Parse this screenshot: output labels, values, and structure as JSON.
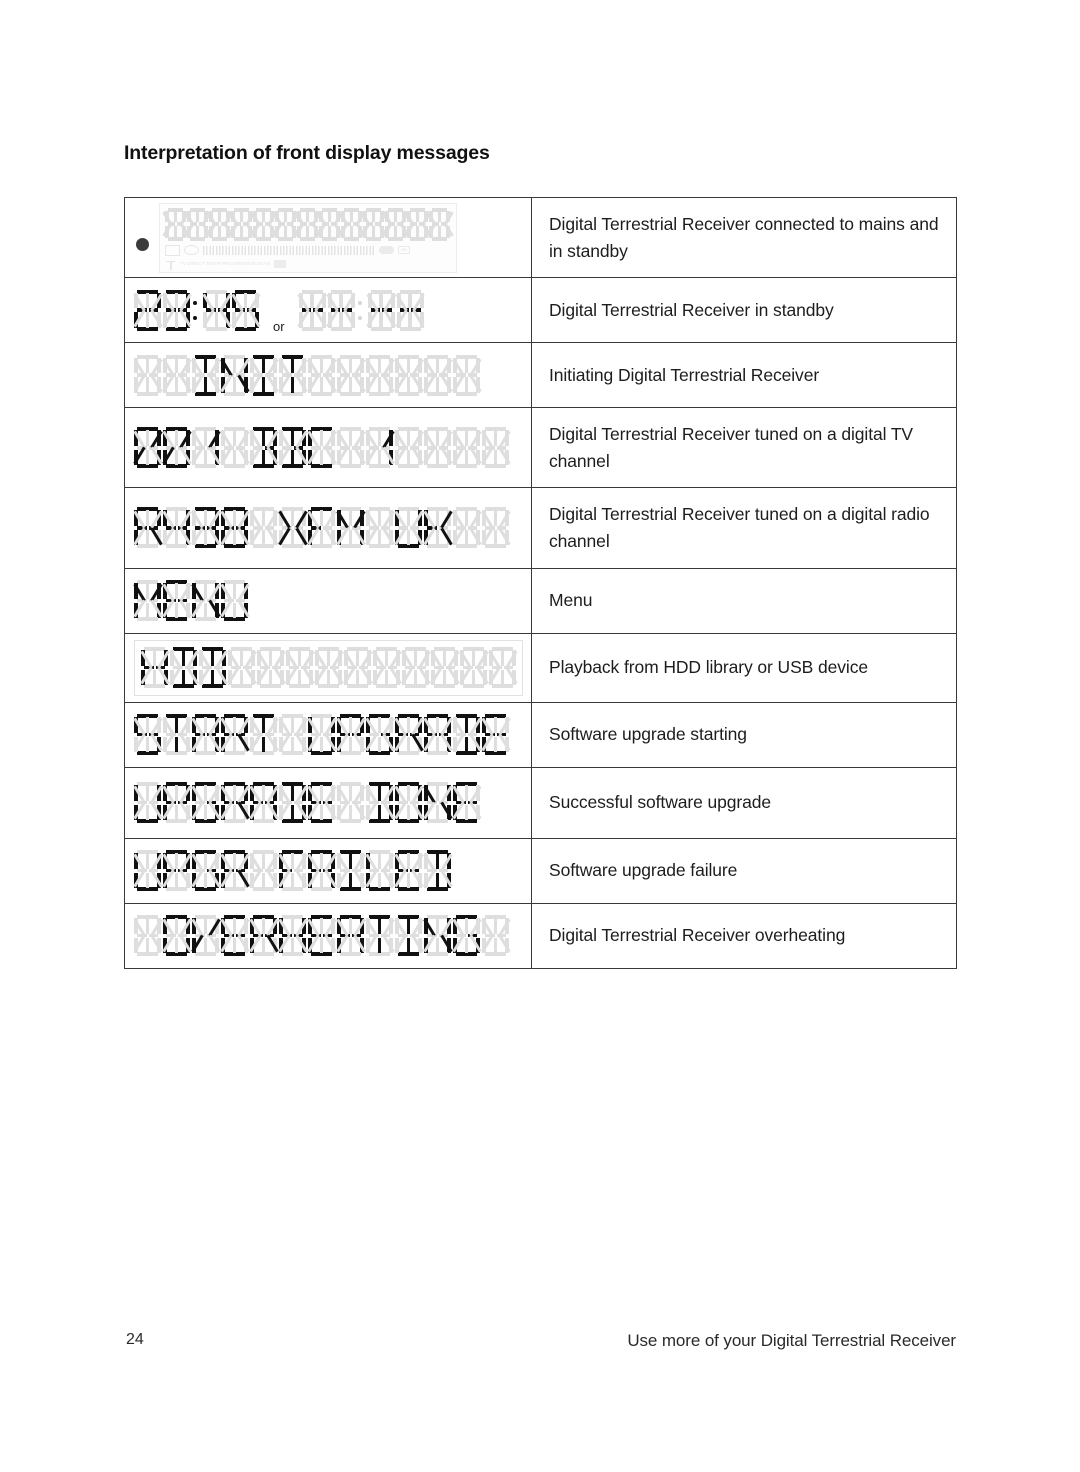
{
  "heading": "Interpretation of front display messages",
  "table": {
    "rows": [
      {
        "display_kind": "standby-panel",
        "display_text": "",
        "cells": 13,
        "description": "Digital Terrestrial Receiver connected to mains and in standby"
      },
      {
        "display_kind": "clock-or-dashes",
        "display_text": "23:45",
        "alt_display_text": "--:--",
        "or_label": "or",
        "description": "Digital Terrestrial Receiver in standby"
      },
      {
        "display_kind": "segments",
        "display_text": "  INIT      ",
        "cells": 13,
        "description": "Initiating Digital Terrestrial Receiver"
      },
      {
        "display_kind": "segments",
        "display_text": "001 BBC 1    ",
        "cells": 13,
        "description": "Digital Terrestrial Receiver tuned on a digital TV channel"
      },
      {
        "display_kind": "segments",
        "display_text": "R438 XFM UK  ",
        "cells": 13,
        "description": "Digital Terrestrial Receiver tuned on a digital radio channel"
      },
      {
        "display_kind": "segments",
        "display_text": "MENU",
        "cells": 4,
        "description": "Menu"
      },
      {
        "display_kind": "segments-framed",
        "display_text": "HDD          ",
        "cells": 13,
        "description": "Playback from HDD library or USB device"
      },
      {
        "display_kind": "segments",
        "display_text": "START UPGRADE",
        "cells": 13,
        "description": "Software upgrade starting"
      },
      {
        "display_kind": "segments",
        "display_text": "UPGRADE DONE",
        "cells": 12,
        "description": "Successful software upgrade"
      },
      {
        "display_kind": "segments",
        "display_text": "UPGR FAILED",
        "cells": 11,
        "description": "Software upgrade failure"
      },
      {
        "display_kind": "segments",
        "display_text": " OVERHEATING ",
        "cells": 13,
        "description": "Digital Terrestrial Receiver overheating"
      }
    ]
  },
  "standby_panel": {
    "char_cells": 13,
    "indicator_labels": "TV DIRECT   TIMER   PROGRESSIVE SCAN"
  },
  "footer": {
    "page_number": "24",
    "running_title": "Use more of your Digital Terrestrial Receiver"
  }
}
